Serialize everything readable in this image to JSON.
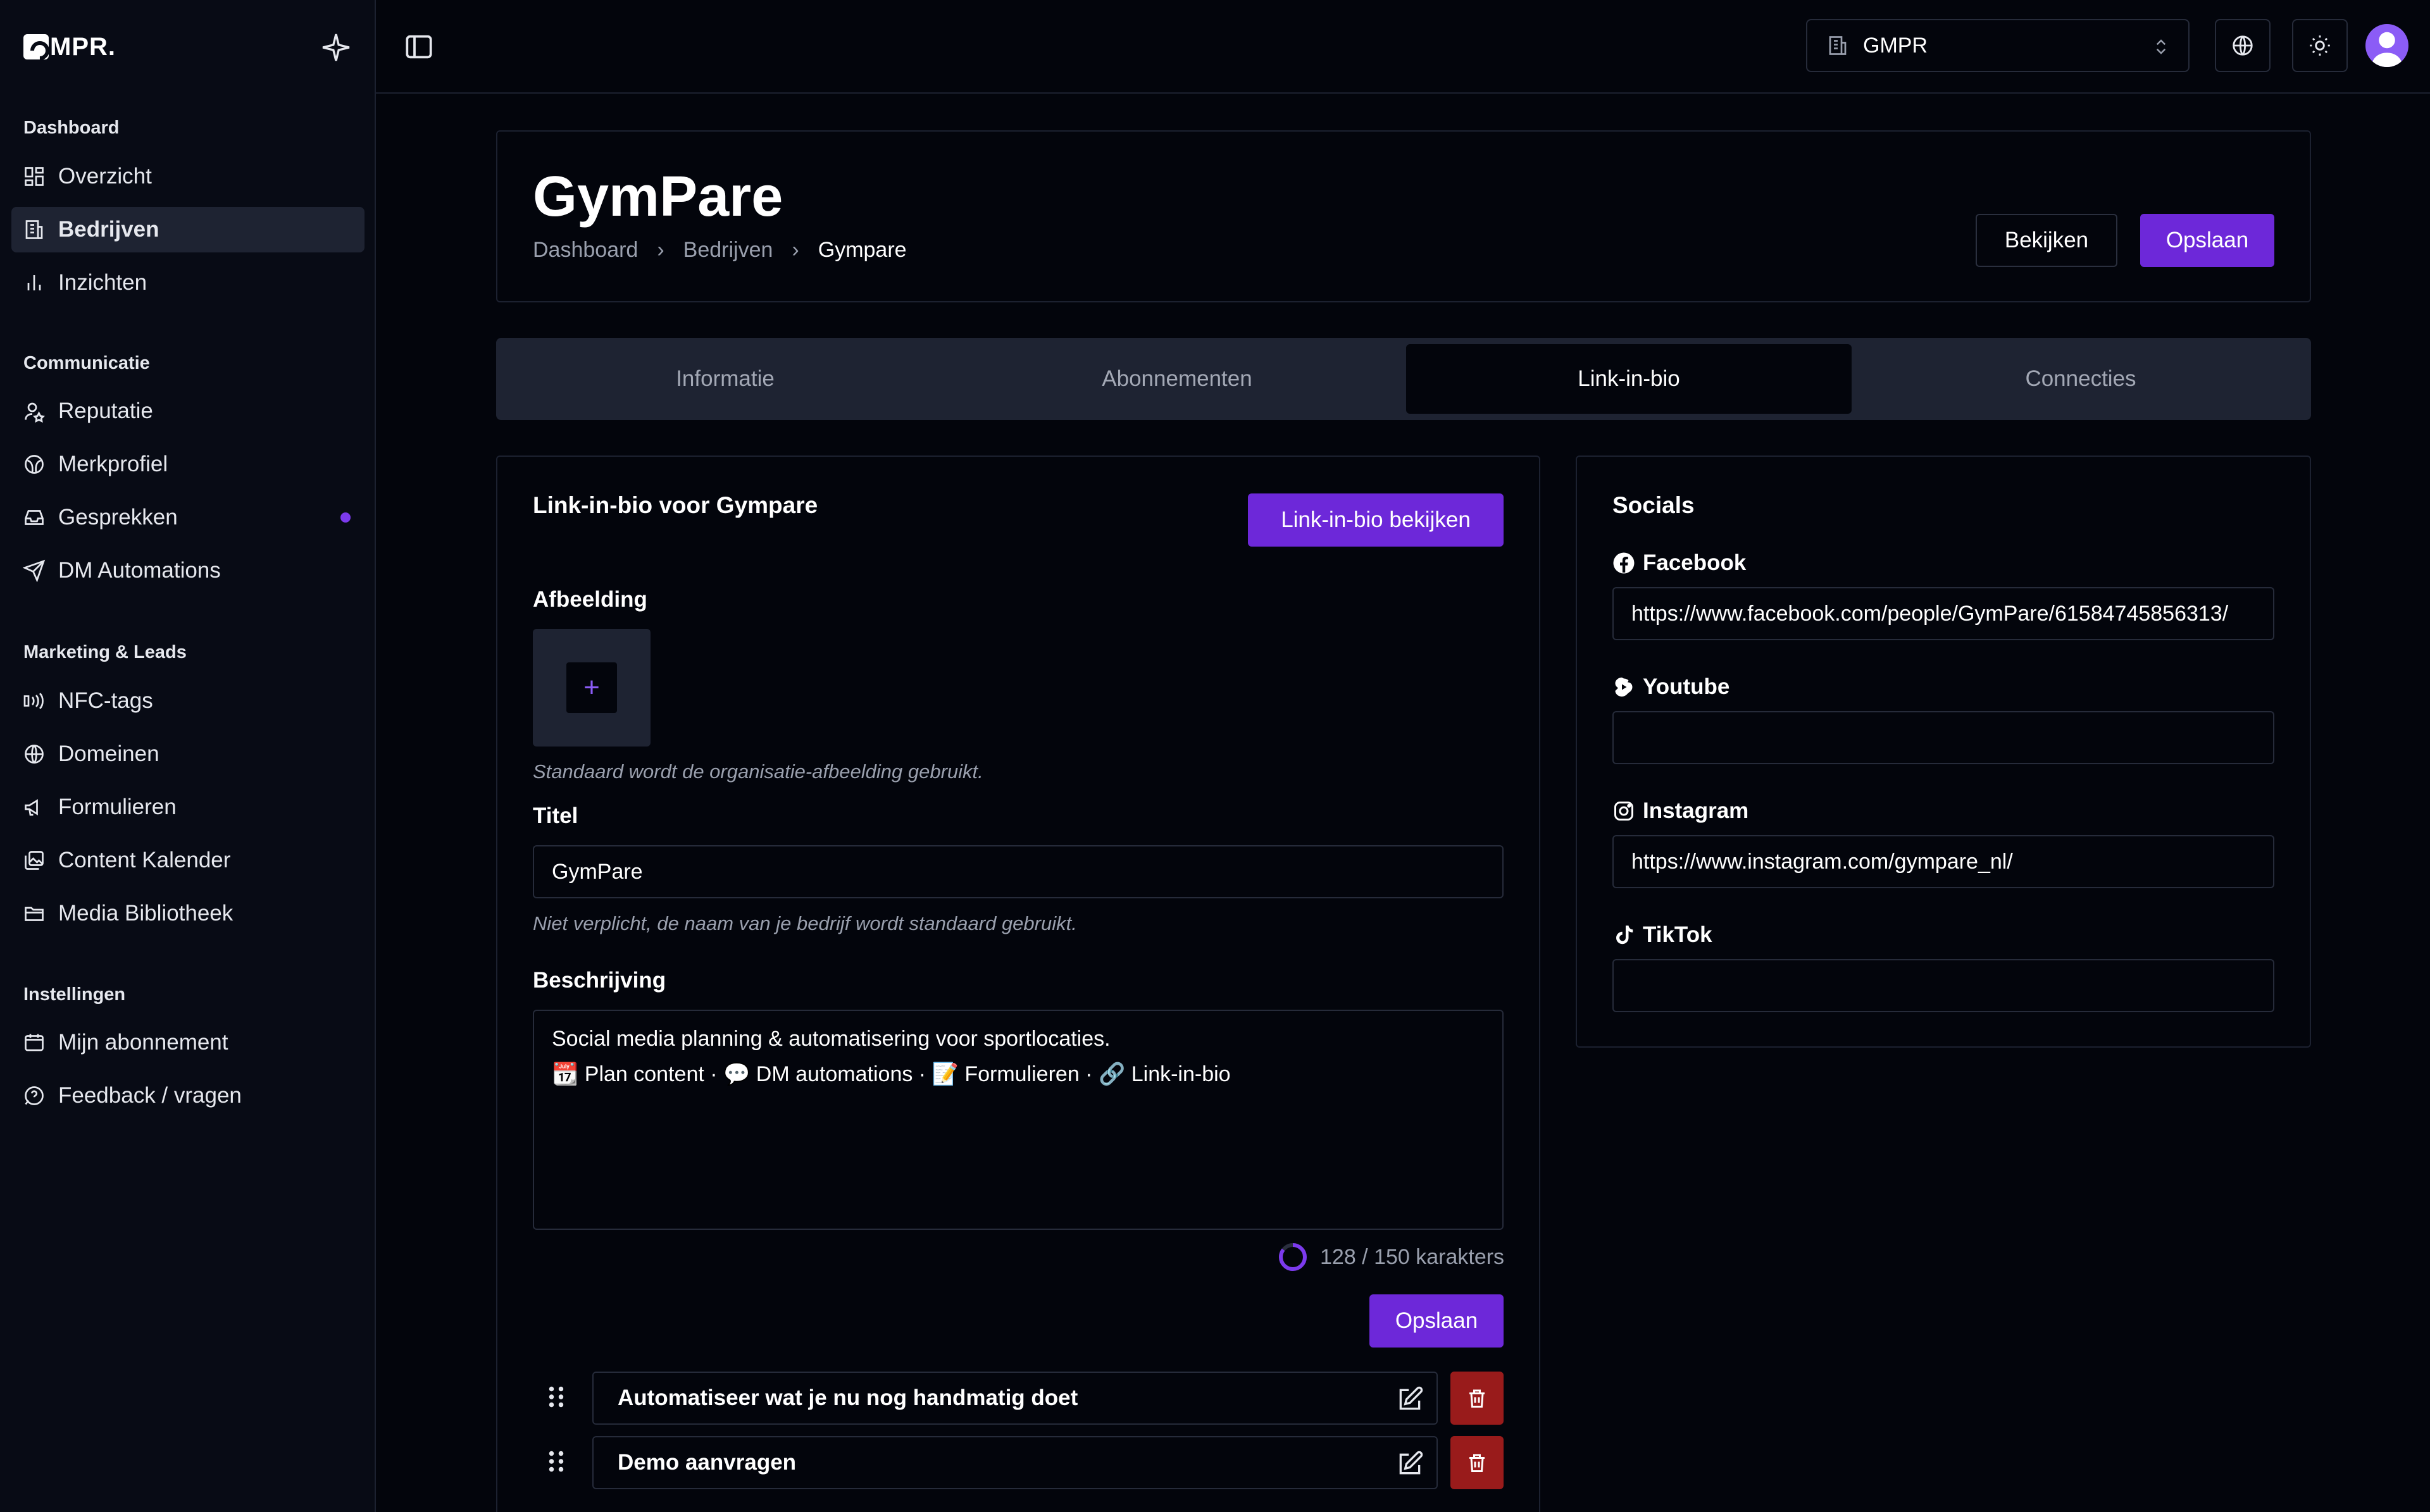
{
  "app": {
    "logo_text": "MPR."
  },
  "topbar": {
    "org_name": "GMPR"
  },
  "sidebar": {
    "sections": [
      {
        "label": "Dashboard",
        "items": [
          {
            "label": "Overzicht",
            "icon": "grid-icon"
          },
          {
            "label": "Bedrijven",
            "icon": "building-icon",
            "active": true
          },
          {
            "label": "Inzichten",
            "icon": "bar-chart-icon"
          }
        ]
      },
      {
        "label": "Communicatie",
        "items": [
          {
            "label": "Reputatie",
            "icon": "user-star-icon"
          },
          {
            "label": "Merkprofiel",
            "icon": "globe-lines-icon"
          },
          {
            "label": "Gesprekken",
            "icon": "inbox-icon",
            "badge": true
          },
          {
            "label": "DM Automations",
            "icon": "send-icon"
          }
        ]
      },
      {
        "label": "Marketing & Leads",
        "items": [
          {
            "label": "NFC-tags",
            "icon": "nfc-icon"
          },
          {
            "label": "Domeinen",
            "icon": "globe-icon"
          },
          {
            "label": "Formulieren",
            "icon": "megaphone-icon"
          },
          {
            "label": "Content Kalender",
            "icon": "images-icon"
          },
          {
            "label": "Media Bibliotheek",
            "icon": "folder-icon"
          }
        ]
      },
      {
        "label": "Instellingen",
        "items": [
          {
            "label": "Mijn abonnement",
            "icon": "card-icon"
          },
          {
            "label": "Feedback / vragen",
            "icon": "help-icon"
          }
        ]
      }
    ]
  },
  "header": {
    "title": "GymPare",
    "breadcrumb": [
      "Dashboard",
      "Bedrijven",
      "Gympare"
    ],
    "view_button": "Bekijken",
    "save_button": "Opslaan"
  },
  "tabs": [
    {
      "label": "Informatie",
      "active": false
    },
    {
      "label": "Abonnementen",
      "active": false
    },
    {
      "label": "Link-in-bio",
      "active": true
    },
    {
      "label": "Connecties",
      "active": false
    }
  ],
  "linkinbio": {
    "heading": "Link-in-bio voor Gympare",
    "view_button": "Link-in-bio bekijken",
    "image_label": "Afbeelding",
    "image_hint": "Standaard wordt de organisatie-afbeelding gebruikt.",
    "title_label": "Titel",
    "title_value": "GymPare",
    "title_hint": "Niet verplicht, de naam van je bedrijf wordt standaard gebruikt.",
    "description_label": "Beschrijving",
    "description_line1": "Social media planning & automatisering voor sportlocaties.",
    "description_line2": "📆 Plan content · 💬 DM automations · 📝 Formulieren · 🔗 Link-in-bio",
    "char_count": 128,
    "char_max": 150,
    "char_counter_text": "128 / 150 karakters",
    "save_button": "Opslaan",
    "links": [
      {
        "label": "Automatiseer wat je nu nog handmatig doet"
      },
      {
        "label": "Demo aanvragen"
      }
    ]
  },
  "socials": {
    "heading": "Socials",
    "facebook_label": "Facebook",
    "facebook_value": "https://www.facebook.com/people/GymPare/61584745856313/",
    "youtube_label": "Youtube",
    "youtube_value": "",
    "instagram_label": "Instagram",
    "instagram_value": "https://www.instagram.com/gympare_nl/",
    "tiktok_label": "TikTok",
    "tiktok_value": ""
  },
  "colors": {
    "accent": "#6d28d9",
    "danger": "#991b1b",
    "background": "#03050c"
  }
}
